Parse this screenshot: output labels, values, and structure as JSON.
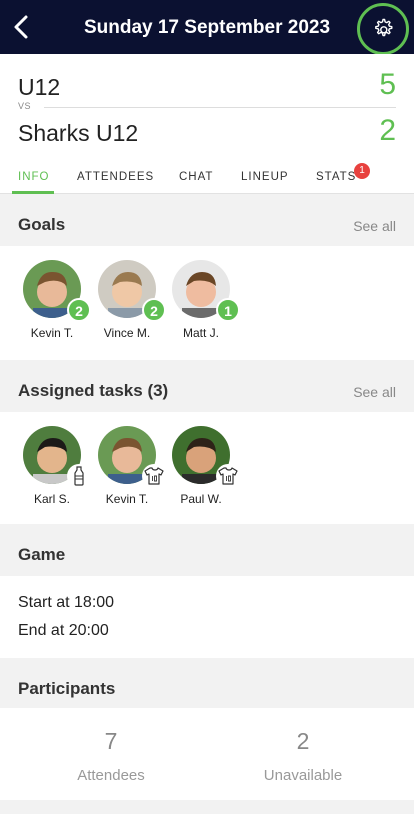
{
  "header": {
    "title": "Sunday 17 September 2023",
    "back_icon": "chevron-left-icon",
    "settings_icon": "gear-icon",
    "accent": "#5fbf52",
    "bar_color": "#0b1131"
  },
  "match": {
    "home_team": "U12",
    "vs": "VS",
    "away_team": "Sharks U12",
    "home_score": "5",
    "away_score": "2"
  },
  "tabs": [
    {
      "label": "INFO",
      "active": true
    },
    {
      "label": "ATTENDEES"
    },
    {
      "label": "CHAT"
    },
    {
      "label": "LINEUP"
    },
    {
      "label": "STATS",
      "badge": "1"
    }
  ],
  "goals": {
    "title": "Goals",
    "see_all": "See all",
    "players": [
      {
        "name": "Kevin T.",
        "count": "2"
      },
      {
        "name": "Vince M.",
        "count": "2"
      },
      {
        "name": "Matt J.",
        "count": "1"
      }
    ]
  },
  "tasks": {
    "title": "Assigned tasks (3)",
    "see_all": "See all",
    "players": [
      {
        "name": "Karl S.",
        "task_icon": "water-bottle-icon"
      },
      {
        "name": "Kevin T.",
        "task_icon": "jersey-icon"
      },
      {
        "name": "Paul W.",
        "task_icon": "jersey-icon"
      }
    ]
  },
  "game": {
    "title": "Game",
    "start": "Start at 18:00",
    "end": "End at 20:00"
  },
  "participants": {
    "title": "Participants",
    "attendees_count": "7",
    "attendees_label": "Attendees",
    "unavailable_count": "2",
    "unavailable_label": "Unavailable"
  }
}
